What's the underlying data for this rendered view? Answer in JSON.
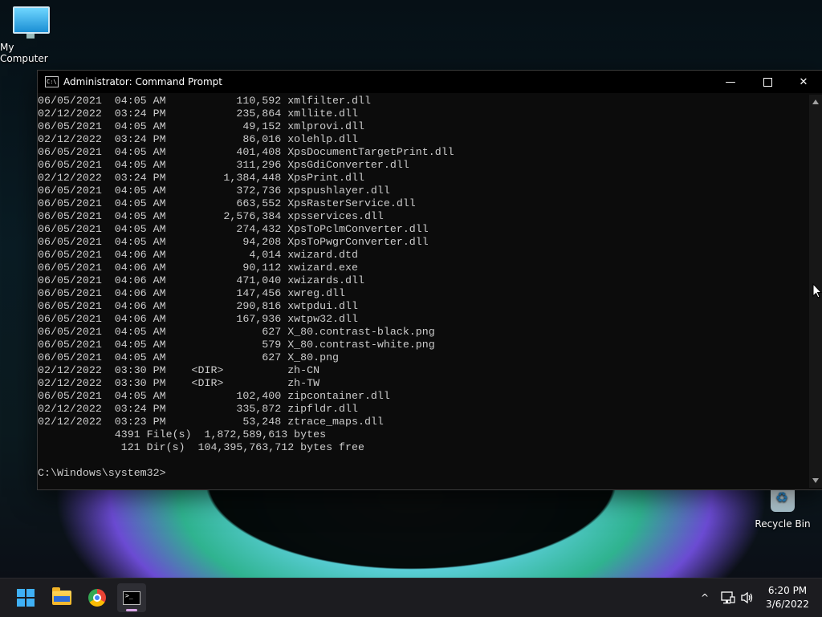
{
  "desktop": {
    "icons": [
      {
        "label": "My Computer",
        "icon": "monitor-icon"
      },
      {
        "label": "Recycle Bin",
        "icon": "recycle-bin-icon"
      }
    ]
  },
  "window": {
    "title": "Administrator: Command Prompt",
    "minimize_glyph": "—",
    "close_glyph": "✕"
  },
  "console": {
    "lines": [
      "06/05/2021  04:05 AM           110,592 xmlfilter.dll",
      "02/12/2022  03:24 PM           235,864 xmllite.dll",
      "06/05/2021  04:05 AM            49,152 xmlprovi.dll",
      "02/12/2022  03:24 PM            86,016 xolehlp.dll",
      "06/05/2021  04:05 AM           401,408 XpsDocumentTargetPrint.dll",
      "06/05/2021  04:05 AM           311,296 XpsGdiConverter.dll",
      "02/12/2022  03:24 PM         1,384,448 XpsPrint.dll",
      "06/05/2021  04:05 AM           372,736 xpspushlayer.dll",
      "06/05/2021  04:05 AM           663,552 XpsRasterService.dll",
      "06/05/2021  04:05 AM         2,576,384 xpsservices.dll",
      "06/05/2021  04:05 AM           274,432 XpsToPclmConverter.dll",
      "06/05/2021  04:05 AM            94,208 XpsToPwgrConverter.dll",
      "06/05/2021  04:06 AM             4,014 xwizard.dtd",
      "06/05/2021  04:06 AM            90,112 xwizard.exe",
      "06/05/2021  04:06 AM           471,040 xwizards.dll",
      "06/05/2021  04:06 AM           147,456 xwreg.dll",
      "06/05/2021  04:06 AM           290,816 xwtpdui.dll",
      "06/05/2021  04:06 AM           167,936 xwtpw32.dll",
      "06/05/2021  04:05 AM               627 X_80.contrast-black.png",
      "06/05/2021  04:05 AM               579 X_80.contrast-white.png",
      "06/05/2021  04:05 AM               627 X_80.png",
      "02/12/2022  03:30 PM    <DIR>          zh-CN",
      "02/12/2022  03:30 PM    <DIR>          zh-TW",
      "06/05/2021  04:05 AM           102,400 zipcontainer.dll",
      "02/12/2022  03:24 PM           335,872 zipfldr.dll",
      "02/12/2022  03:23 PM            53,248 ztrace_maps.dll",
      "            4391 File(s)  1,872,589,613 bytes",
      "             121 Dir(s)  104,395,763,712 bytes free",
      "",
      "C:\\Windows\\system32>"
    ]
  },
  "taskbar": {
    "buttons": [
      "start",
      "file-explorer",
      "google-chrome",
      "command-prompt"
    ],
    "active": "command-prompt",
    "accent_color": "#d9a7e6",
    "tray": {
      "chevron": "^",
      "time": "6:20 PM",
      "date": "3/6/2022"
    }
  }
}
